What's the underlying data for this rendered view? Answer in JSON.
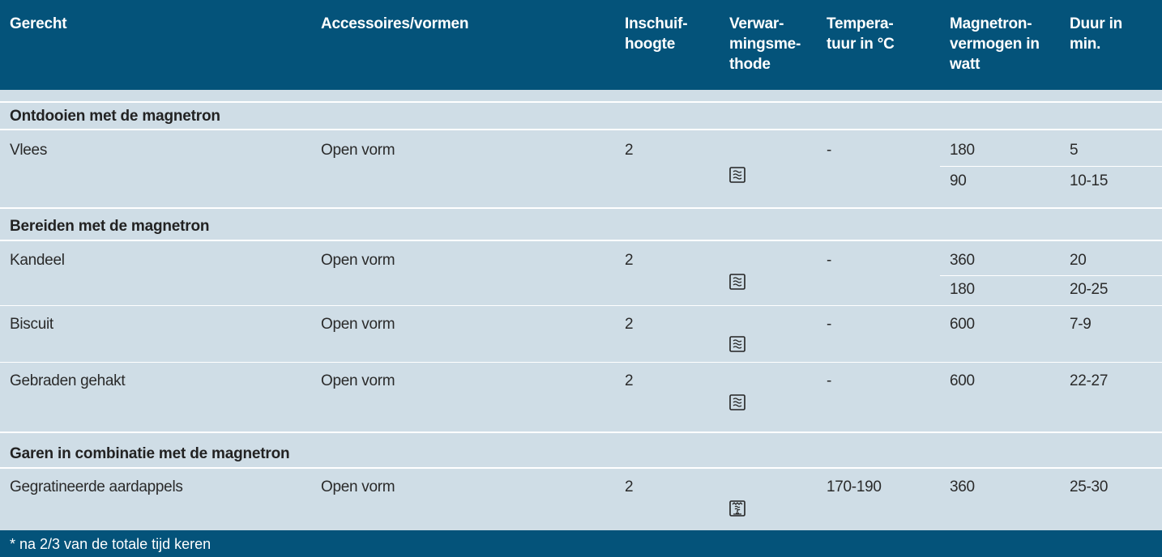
{
  "headers": {
    "gerecht": [
      "Gerecht"
    ],
    "accessoires": [
      "Accessoires/vormen"
    ],
    "inschuif": [
      "Inschuif-",
      "hoogte"
    ],
    "verwarming": [
      "Verwar-",
      "mingsme-",
      "thode"
    ],
    "temperatuur": [
      "Tempera-",
      "tuur in °C"
    ],
    "magnetron": [
      "Magnetron-",
      "vermogen in",
      "watt"
    ],
    "duur": [
      "Duur in",
      "min."
    ]
  },
  "sections": [
    {
      "title": "Ontdooien met de magnetron",
      "rows": [
        {
          "gerecht": "Vlees",
          "accessoire": "Open vorm",
          "inschuif": "2",
          "methode_icon": "microwave-icon",
          "temperatuur": "-",
          "steps": [
            {
              "watt": "180",
              "duur": "5"
            },
            {
              "watt": "90",
              "duur": "10-15"
            }
          ]
        }
      ]
    },
    {
      "title": "Bereiden met de magnetron",
      "rows": [
        {
          "gerecht": "Kandeel",
          "accessoire": "Open vorm",
          "inschuif": "2",
          "methode_icon": "microwave-icon",
          "temperatuur": "-",
          "steps": [
            {
              "watt": "360",
              "duur": "20"
            },
            {
              "watt": "180",
              "duur": "20-25"
            }
          ]
        },
        {
          "gerecht": "Biscuit",
          "accessoire": "Open vorm",
          "inschuif": "2",
          "methode_icon": "microwave-icon",
          "temperatuur": "-",
          "steps": [
            {
              "watt": "600",
              "duur": "7-9"
            }
          ]
        },
        {
          "gerecht": "Gebraden gehakt",
          "accessoire": "Open vorm",
          "inschuif": "2",
          "methode_icon": "microwave-icon",
          "temperatuur": "-",
          "steps": [
            {
              "watt": "600",
              "duur": "22-27"
            }
          ]
        }
      ]
    },
    {
      "title": "Garen in combinatie met de magnetron",
      "rows": [
        {
          "gerecht": "Gegratineerde aardappels",
          "accessoire": "Open vorm",
          "inschuif": "2",
          "methode_icon": "combi-grill-icon",
          "temperatuur": "170-190",
          "steps": [
            {
              "watt": "360",
              "duur": "25-30"
            }
          ]
        }
      ]
    }
  ],
  "footer": {
    "note": "* na 2/3 van de totale tijd keren"
  },
  "colors": {
    "header_bg": "#04537a",
    "row_bg": "#cfdde6",
    "divider": "#ffffff"
  }
}
